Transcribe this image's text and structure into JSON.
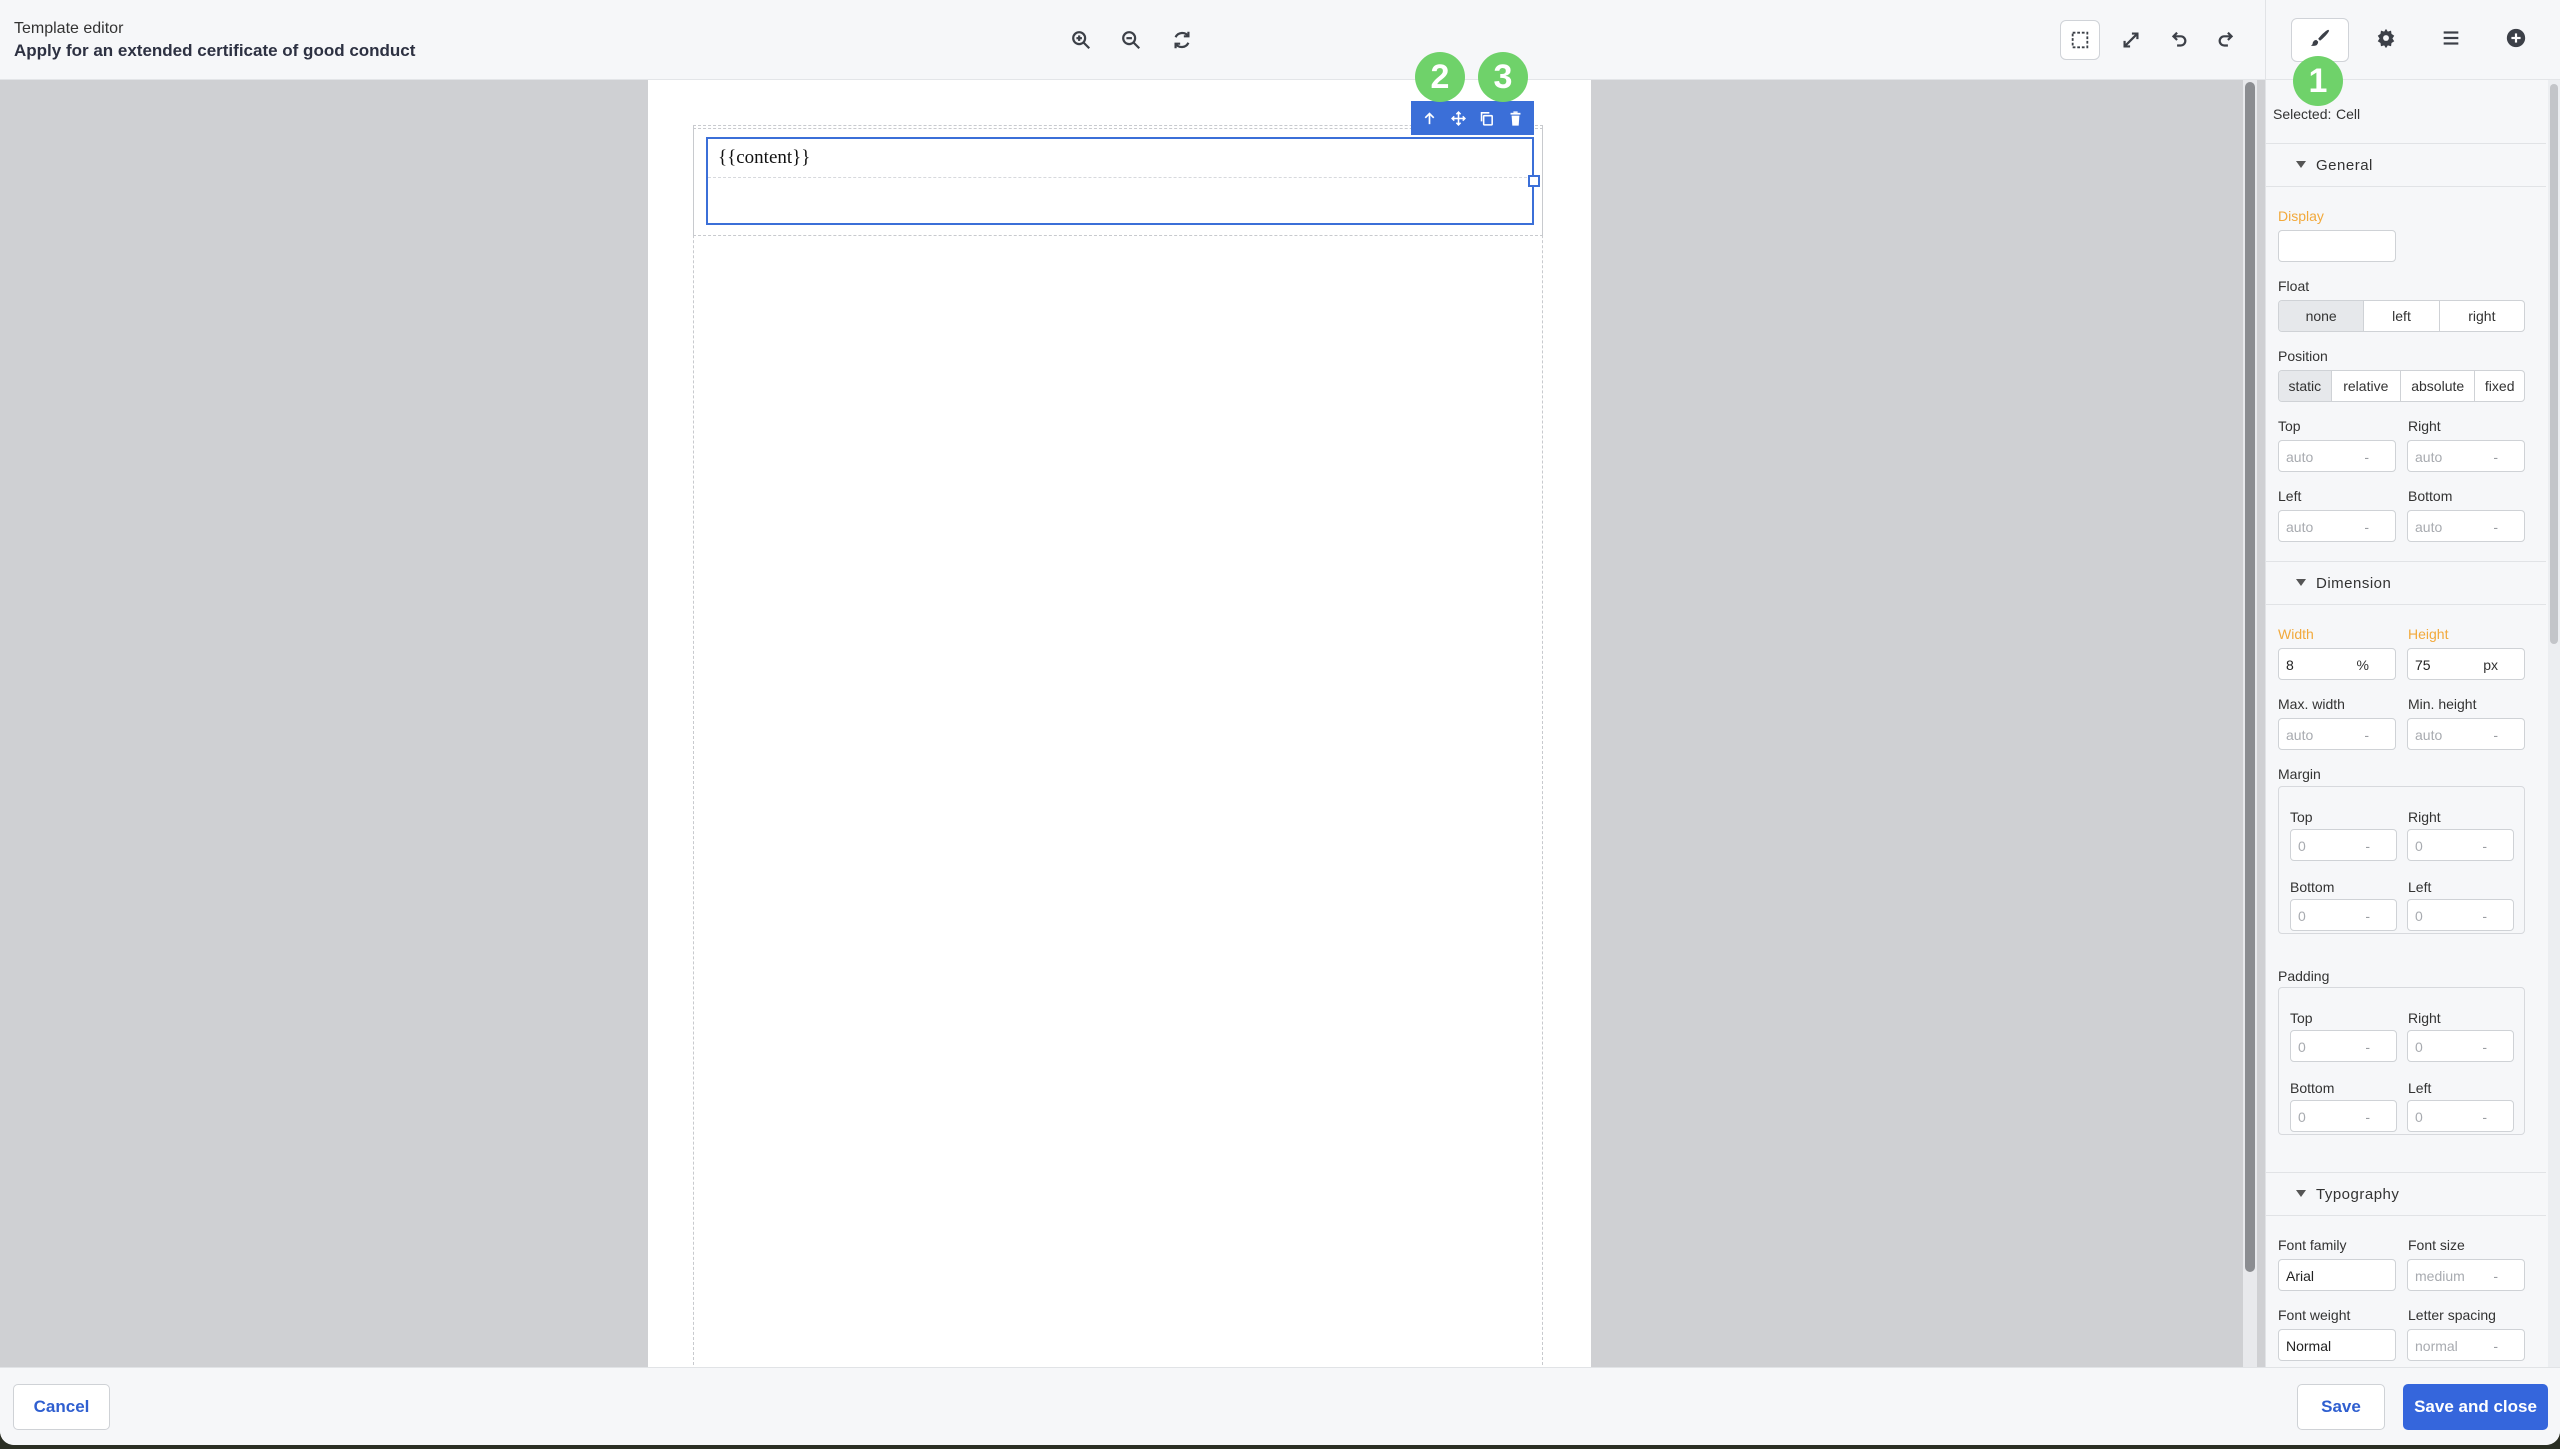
{
  "header": {
    "subtitle": "Template editor",
    "title": "Apply for an extended certificate of good conduct"
  },
  "canvas": {
    "cell_text": "{{content}}"
  },
  "badges": [
    "1",
    "2",
    "3"
  ],
  "panel": {
    "selected_label": "Selected:",
    "selected_value": "Cell",
    "general": {
      "title": "General",
      "display_label": "Display",
      "display_value": "",
      "float_label": "Float",
      "float_options": [
        "none",
        "left",
        "right"
      ],
      "position_label": "Position",
      "position_options": [
        "static",
        "relative",
        "absolute",
        "fixed"
      ],
      "top_label": "Top",
      "right_label": "Right",
      "left_label": "Left",
      "bottom_label": "Bottom",
      "auto": "auto",
      "dash": "-"
    },
    "dimension": {
      "title": "Dimension",
      "width_label": "Width",
      "width_value": "8",
      "width_unit": "%",
      "height_label": "Height",
      "height_value": "75",
      "height_unit": "px",
      "max_width_label": "Max. width",
      "min_height_label": "Min. height",
      "auto": "auto",
      "dash": "-",
      "margin_label": "Margin",
      "padding_label": "Padding",
      "top_label": "Top",
      "right_label": "Right",
      "bottom_label": "Bottom",
      "left_label": "Left",
      "zero": "0"
    },
    "typography": {
      "title": "Typography",
      "font_family_label": "Font family",
      "font_family_value": "Arial",
      "font_size_label": "Font size",
      "font_size_placeholder": "medium",
      "font_weight_label": "Font weight",
      "font_weight_value": "Normal",
      "letter_spacing_label": "Letter spacing",
      "letter_spacing_placeholder": "normal",
      "dash": "-"
    }
  },
  "footer": {
    "cancel": "Cancel",
    "save": "Save",
    "save_close": "Save and close"
  }
}
